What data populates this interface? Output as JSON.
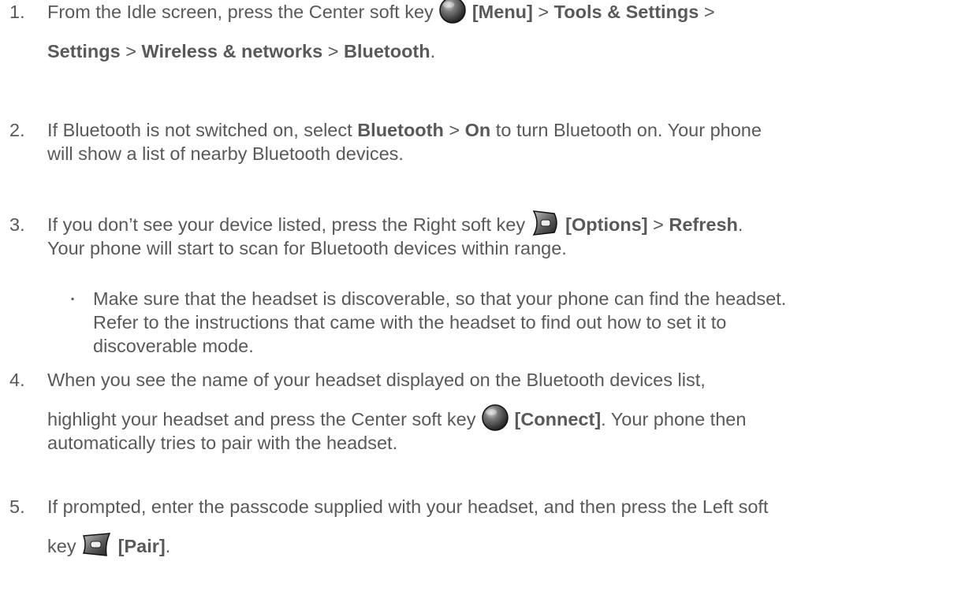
{
  "steps": [
    {
      "num": "1.",
      "lines": [
        {
          "parts": [
            {
              "t": "From the Idle screen, press the Center soft key "
            },
            {
              "icon": "center"
            },
            {
              "b": " [Menu]"
            },
            {
              "t": " > "
            },
            {
              "b": "Tools & Settings"
            },
            {
              "t": " >"
            }
          ]
        },
        {
          "parts": [
            {
              "b": "Settings"
            },
            {
              "t": " > "
            },
            {
              "b": "Wireless & networks"
            },
            {
              "t": " > "
            },
            {
              "b": "Bluetooth"
            },
            {
              "t": "."
            }
          ]
        }
      ]
    },
    {
      "num": "2.",
      "lines": [
        {
          "parts": [
            {
              "t": "If Bluetooth is not switched on, select "
            },
            {
              "b": "Bluetooth"
            },
            {
              "t": " > "
            },
            {
              "b": "On"
            },
            {
              "t": " to turn Bluetooth on. Your phone"
            }
          ]
        },
        {
          "parts": [
            {
              "t": "will show a list of nearby Bluetooth devices."
            }
          ]
        }
      ]
    },
    {
      "num": "3.",
      "lines": [
        {
          "parts": [
            {
              "t": "If you don’t see your device listed, press the Right soft key "
            },
            {
              "icon": "right"
            },
            {
              "b": " [Options]"
            },
            {
              "t": " > "
            },
            {
              "b": "Refresh"
            },
            {
              "t": "."
            }
          ]
        },
        {
          "parts": [
            {
              "t": "Your phone will start to scan for Bluetooth devices within range."
            }
          ]
        }
      ],
      "bullet": {
        "mark": "▪",
        "lines": [
          "Make sure that the headset is discoverable, so that your phone can find the headset.",
          "Refer to the instructions that came with the headset to find out how to set it to",
          "discoverable mode."
        ]
      }
    },
    {
      "num": "4.",
      "lines": [
        {
          "parts": [
            {
              "t": "When you see the name of your headset displayed on the Bluetooth devices list,"
            }
          ]
        },
        {
          "parts": [
            {
              "t": "highlight your headset and press the Center soft key "
            },
            {
              "icon": "center"
            },
            {
              "b": " [Connect]"
            },
            {
              "t": ". Your phone then"
            }
          ]
        },
        {
          "parts": [
            {
              "t": "automatically tries to pair with the headset."
            }
          ]
        }
      ]
    },
    {
      "num": "5.",
      "lines": [
        {
          "parts": [
            {
              "t": "If prompted, enter the passcode supplied with your headset, and then press the Left soft"
            }
          ]
        },
        {
          "parts": [
            {
              "t": "key "
            },
            {
              "icon": "left"
            },
            {
              "b": " [Pair]"
            },
            {
              "t": "."
            }
          ]
        }
      ]
    }
  ],
  "icons": {
    "center": "center-soft-key-icon",
    "right": "right-soft-key-icon",
    "left": "left-soft-key-icon"
  }
}
